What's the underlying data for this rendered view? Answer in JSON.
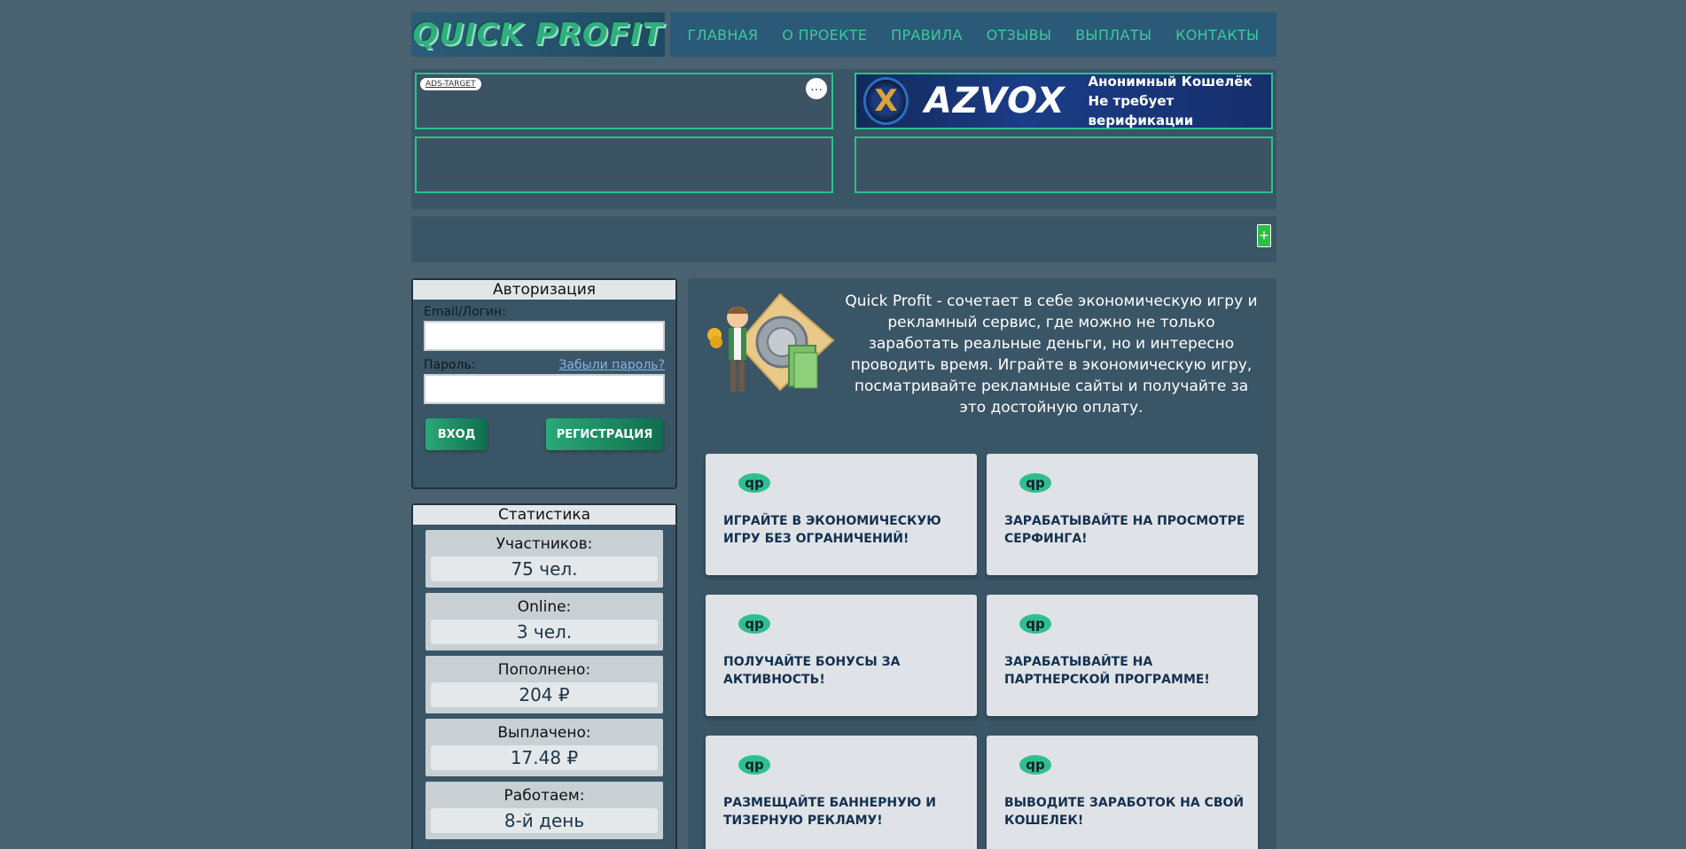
{
  "header": {
    "logo_text": "QUICK PROFIT",
    "nav": [
      "ГЛАВНАЯ",
      "О ПРОЕКТЕ",
      "ПРАВИЛА",
      "ОТЗЫВЫ",
      "ВЫПЛАТЫ",
      "КОНТАКТЫ"
    ]
  },
  "ads": {
    "tag": "ADS-TARGET",
    "menu": "…",
    "banner": {
      "brand": "AZVOX",
      "line1": "Анонимный Кошелёк",
      "line2": "Не требует верификации"
    },
    "plus": "+"
  },
  "auth": {
    "title": "Авторизация",
    "email_label": "Email/Логин:",
    "password_label": "Пароль:",
    "forgot": "Забыли пароль?",
    "login_button": "ВХОД",
    "register_button": "РЕГИСТРАЦИЯ"
  },
  "stats": {
    "title": "Статистика",
    "items": [
      {
        "label": "Участников:",
        "value": "75 чел."
      },
      {
        "label": "Online:",
        "value": "3 чел."
      },
      {
        "label": "Пополнено:",
        "value": "204 ₽"
      },
      {
        "label": "Выплачено:",
        "value": "17.48 ₽"
      },
      {
        "label": "Работаем:",
        "value": "8-й день"
      }
    ]
  },
  "main": {
    "intro": "Quick Profit - сочетает в себе экономическую игру и рекламный сервис, где можно не только заработать реальные деньги, но и интересно проводить время. Играйте в экономическую игру, посматривайте рекламные сайты и получайте за это достойную оплату.",
    "cards": [
      "ИГРАЙТЕ В ЭКОНОМИЧЕСКУЮ ИГРУ БЕЗ ОГРАНИЧЕНИЙ!",
      "ЗАРАБАТЫВАЙТЕ НА ПРОСМОТРЕ СЕРФИНГА!",
      "ПОЛУЧАЙТЕ БОНУСЫ ЗА АКТИВНОСТЬ!",
      "ЗАРАБАТЫВАЙТЕ НА ПАРТНЕРСКОЙ ПРОГРАММЕ!",
      "РАЗМЕЩАЙТЕ БАННЕРНУЮ И ТИЗЕРНУЮ РЕКЛАМУ!",
      "ВЫВОДИТЕ ЗАРАБОТОК НА СВОЙ КОШЕЛЕК!"
    ],
    "card_icon_text": "qp"
  },
  "colors": {
    "background": "#4a6270",
    "panel": "#3a5566",
    "accent": "#2fbf8e",
    "nav_text": "#3ec99a"
  }
}
